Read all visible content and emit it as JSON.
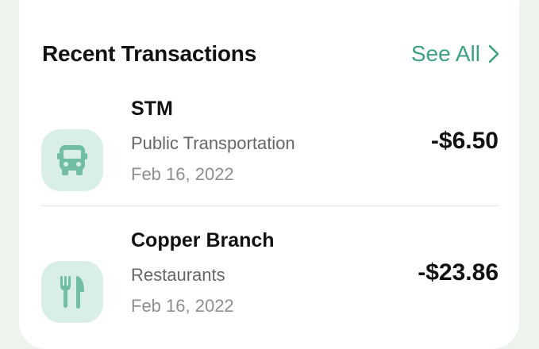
{
  "header": {
    "title": "Recent Transactions",
    "see_all_label": "See All"
  },
  "colors": {
    "accent": "#3f9f82",
    "icon_bg": "#d9efe5"
  },
  "transactions": [
    {
      "name": "STM",
      "category": "Public Transportation",
      "date": "Feb 16, 2022",
      "amount": "-$6.50",
      "icon": "bus-icon"
    },
    {
      "name": "Copper Branch",
      "category": "Restaurants",
      "date": "Feb 16, 2022",
      "amount": "-$23.86",
      "icon": "fork-knife-icon"
    }
  ]
}
